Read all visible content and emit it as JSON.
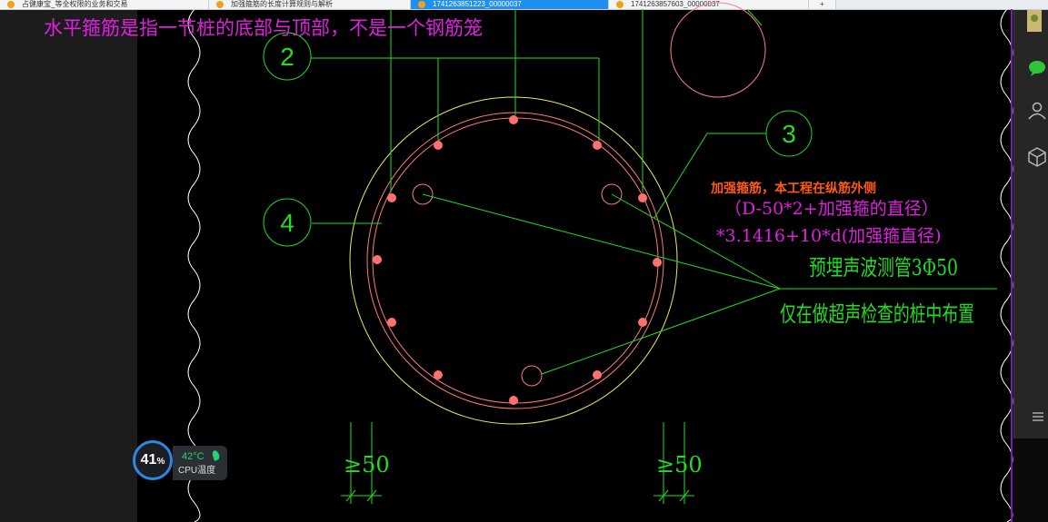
{
  "browser": {
    "tabs": [
      {
        "label": "占健康宝_等全权限的业务和交易"
      },
      {
        "label": "加强箍筋的长度计算规则与解析"
      },
      {
        "label": "1741263851223_00000037"
      },
      {
        "label": "1741263857603_00000037"
      },
      {
        "label": "+"
      }
    ]
  },
  "drawing": {
    "header_note": "水平箍筋是指一节桩的底部与顶部，不是一个钢筋笼",
    "callout_2": "2",
    "callout_3": "3",
    "callout_4": "4",
    "orange_note": "加强箍筋，本工程在纵筋外侧",
    "formula_line1": "（D-50*2+加强箍的直径）",
    "formula_line2": "*3.1416+10*d(加强箍直径)",
    "pipe_label": "预埋声波测管3Φ50",
    "pipe_note": "仅在做超声检查的桩中布置",
    "dim_left": "≥50",
    "dim_right": "≥50"
  },
  "system_monitor": {
    "cpu_percent": "41",
    "percent_sign": "%",
    "temperature": "42°C",
    "label": "CPU温度"
  },
  "colors": {
    "green": "#22dd22",
    "magenta": "#e020e0",
    "outer_circle": "#e8e860",
    "rebar": "#ff7a7a",
    "orange": "#ff5a14",
    "accent_blue": "#1f8ff0"
  },
  "icons": [
    "tab-favicon-icon",
    "leaf-icon",
    "chat-bubble-icon",
    "user-icon",
    "cube-icon",
    "menu-icon"
  ]
}
